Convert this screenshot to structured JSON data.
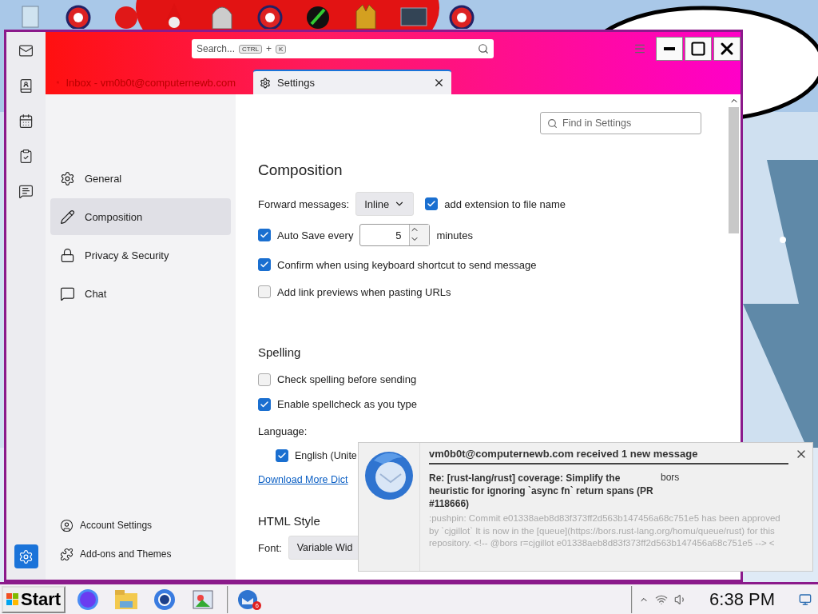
{
  "desktop_icons": [
    {
      "kind": "bin"
    },
    {
      "kind": "ring"
    },
    {
      "kind": "ball"
    },
    {
      "kind": "gnome"
    },
    {
      "kind": "ghost"
    },
    {
      "kind": "ring"
    },
    {
      "kind": "rocket"
    },
    {
      "kind": "gold"
    },
    {
      "kind": "xm"
    },
    {
      "kind": "ring"
    }
  ],
  "window": {
    "spaces": [
      {
        "kind": "mail",
        "selected": false
      },
      {
        "kind": "contacts",
        "selected": false
      },
      {
        "kind": "calendar",
        "selected": false
      },
      {
        "kind": "tasks",
        "selected": false
      },
      {
        "kind": "chat",
        "selected": false
      },
      {
        "kind": "settings",
        "selected": true
      }
    ],
    "search": {
      "placeholder": "Search...",
      "keys": [
        "CTRL",
        "K"
      ],
      "joiner": "+"
    },
    "tabs": [
      {
        "label": "Inbox - vm0b0t@computernewb.com",
        "kind": "mail",
        "selected": false
      },
      {
        "label": "Settings",
        "kind": "settings",
        "selected": true
      }
    ],
    "sidebar": {
      "categories": [
        {
          "label": "General",
          "kind": "general",
          "selected": false
        },
        {
          "label": "Composition",
          "kind": "composition",
          "selected": true
        },
        {
          "label": "Privacy & Security",
          "kind": "privacy",
          "selected": false
        },
        {
          "label": "Chat",
          "kind": "chat",
          "selected": false
        }
      ],
      "footer": [
        {
          "label": "Account Settings",
          "kind": "account"
        },
        {
          "label": "Add-ons and Themes",
          "kind": "addons"
        }
      ]
    },
    "find": {
      "placeholder": "Find in Settings"
    },
    "composition": {
      "title": "Composition",
      "forward": {
        "label": "Forward messages:",
        "value": "Inline",
        "extension": {
          "label": "add extension to file name",
          "checked": true
        }
      },
      "autosave": {
        "label": "Auto Save every",
        "checked": true,
        "value": "5",
        "unit": "minutes"
      },
      "options": [
        {
          "label": "Confirm when using keyboard shortcut to send message",
          "checked": true
        },
        {
          "label": "Add link previews when pasting URLs",
          "checked": false
        }
      ]
    },
    "spelling": {
      "title": "Spelling",
      "options": [
        {
          "label": "Check spelling before sending",
          "checked": false
        },
        {
          "label": "Enable spellcheck as you type",
          "checked": true
        }
      ],
      "language_label": "Language:",
      "languages": [
        {
          "label": "English (Unite",
          "checked": true
        }
      ],
      "link": "Download More Dict"
    },
    "html_style": {
      "title": "HTML Style",
      "font_label": "Font:",
      "font_value": "Variable Wid"
    }
  },
  "notification": {
    "title": "vm0b0t@computernewb.com received 1 new message",
    "subject": "Re: [rust-lang/rust] coverage: Simplify the heuristic for ignoring `async fn` return spans (PR #118666)",
    "sender": "bors",
    "preview": ":pushpin: Commit e01338aeb8d83f373ff2d563b147456a68c751e5 has been approved by `cjgillot` It is now in the [queue](https://bors.rust-lang.org/homu/queue/rust) for this repository. <!-- @bors r=cjgillot e01338aeb8d83f373ff2d563b147456a68c751e5 --> <"
  },
  "taskbar": {
    "start": "Start",
    "apps": [
      {
        "kind": "circle"
      },
      {
        "kind": "folder"
      },
      {
        "kind": "browser"
      },
      {
        "kind": "photos"
      },
      {
        "kind": "bird",
        "badge": "6"
      }
    ],
    "clock": "6:38 PM"
  }
}
